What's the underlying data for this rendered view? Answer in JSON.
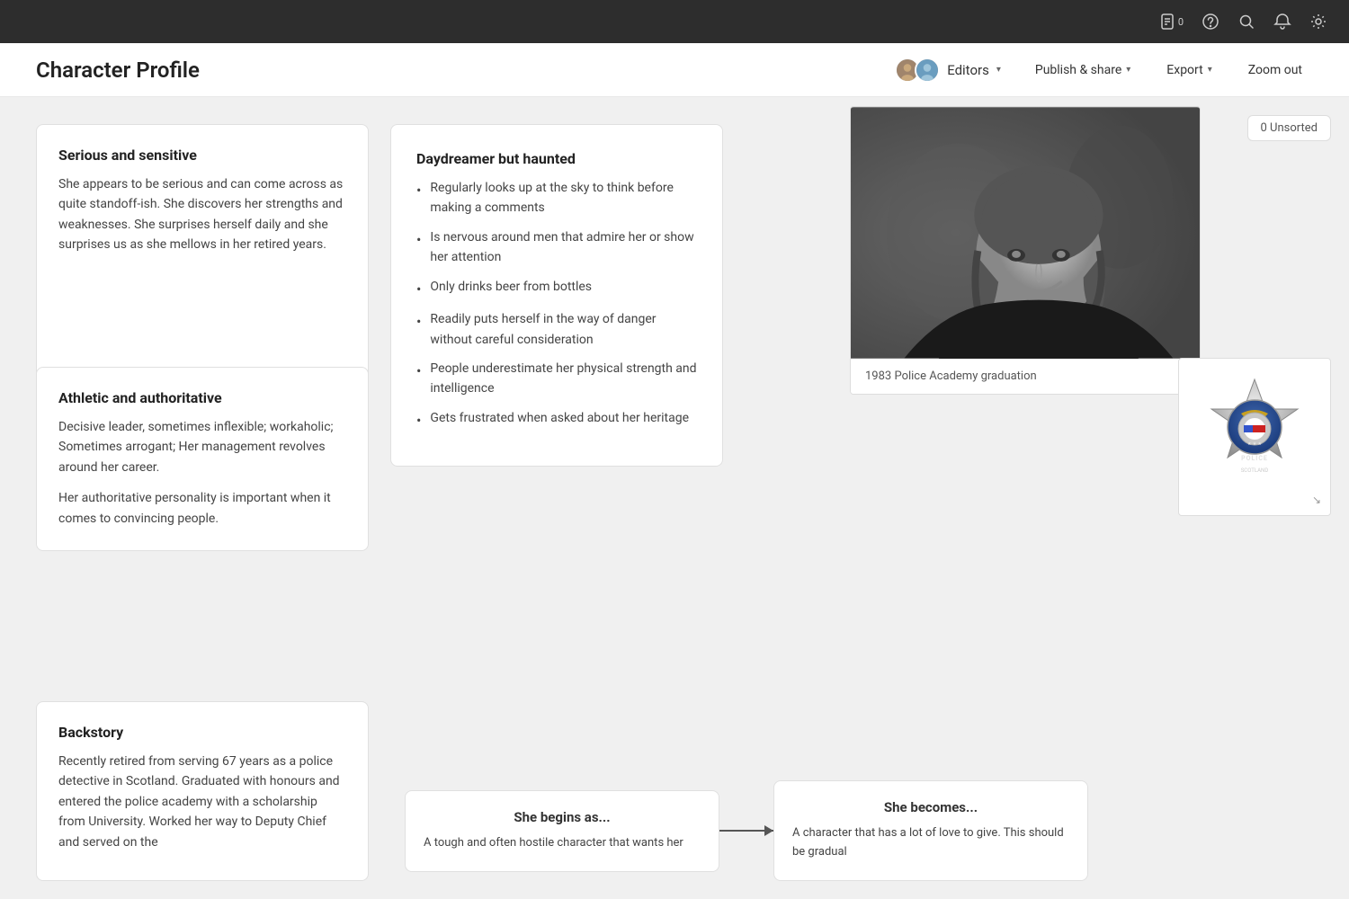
{
  "topbar": {
    "document_icon": "📄",
    "document_count": "0",
    "help_icon": "?",
    "search_icon": "🔍",
    "bell_icon": "🔔",
    "settings_icon": "⚙"
  },
  "header": {
    "title": "Character Profile",
    "editors_label": "Editors",
    "publish_label": "Publish & share",
    "export_label": "Export",
    "zoom_label": "Zoom out"
  },
  "unsorted": {
    "label": "0 Unsorted"
  },
  "card1": {
    "title": "Serious and sensitive",
    "text": "She appears to be serious and can come across as quite standoff-ish. She discovers her strengths and weaknesses. She surprises herself daily and she surprises us as she mellows in her retired years."
  },
  "card2": {
    "title": "Athletic and authoritative",
    "text1": "Decisive leader, sometimes inflexible; workaholic; Sometimes arrogant; Her management revolves around her career.",
    "text2": "Her authoritative personality is important when it comes to convincing people."
  },
  "card3": {
    "title": "Daydreamer but haunted",
    "bullets": [
      "Regularly looks up at the sky to think before making a comments",
      "Is nervous around men that admire her or show her attention",
      "Only drinks beer from bottles",
      "Readily puts herself in the way of danger without careful consideration",
      "People underestimate her physical strength and intelligence",
      "Gets frustrated when asked about her heritage"
    ]
  },
  "photo_caption": "1983 Police Academy graduation",
  "backstory": {
    "title": "Backstory",
    "text": "Recently retired from serving 67 years as a police detective in Scotland. Graduated with honours and entered the police academy with a scholarship from University. Worked her way to Deputy Chief and served on the"
  },
  "arc_begins": {
    "title": "She begins as...",
    "text": "A tough and often hostile character that wants her"
  },
  "arc_becomes": {
    "title": "She becomes...",
    "text": "A character that has a lot of love to give. This should be gradual"
  }
}
